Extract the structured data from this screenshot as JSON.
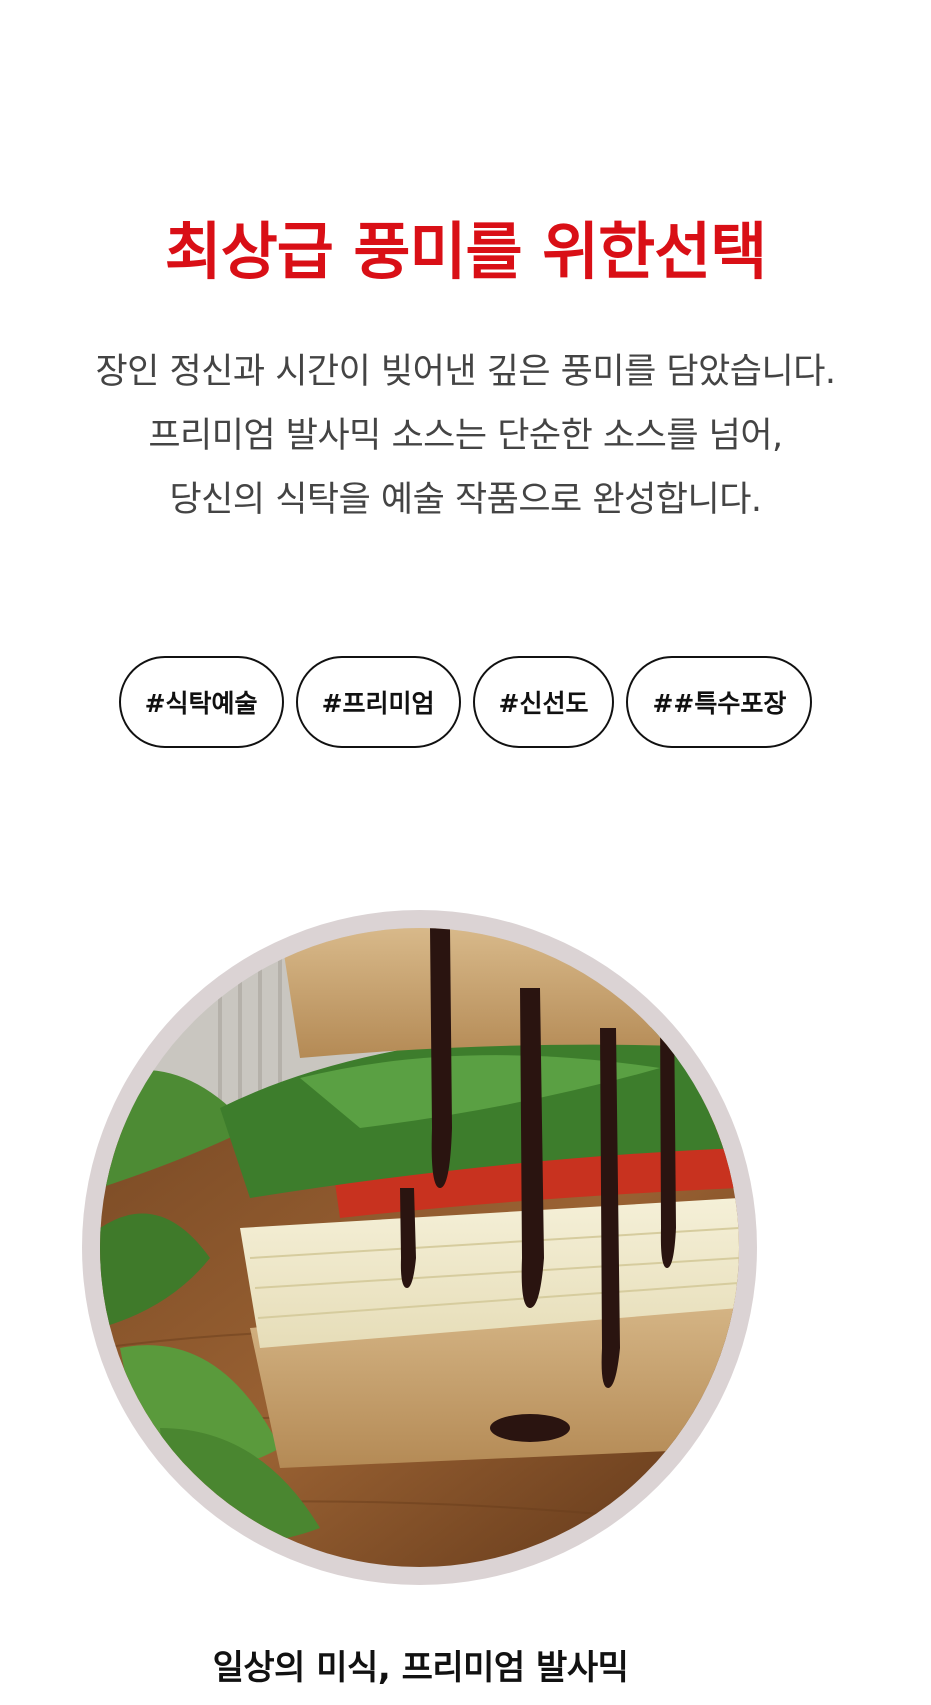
{
  "headline": "최상급 풍미를 위한선택",
  "description": {
    "lines": [
      "장인 정신과 시간이 빚어낸 깊은 풍미를 담았습니다.",
      "프리미엄 발사믹 소스는 단순한 소스를 넘어,",
      "당신의 식탁을 예술 작품으로 완성합니다."
    ]
  },
  "tags": [
    "#식탁예술",
    "#프리미엄",
    "#신선도",
    "##특수포장"
  ],
  "image": {
    "subject": "sandwich-balsamic-photo"
  },
  "caption": "일상의 미식, 프리미엄 발사믹",
  "colors": {
    "accent": "#d90f16",
    "ring": "#dbd3d4",
    "text": "#444444"
  }
}
